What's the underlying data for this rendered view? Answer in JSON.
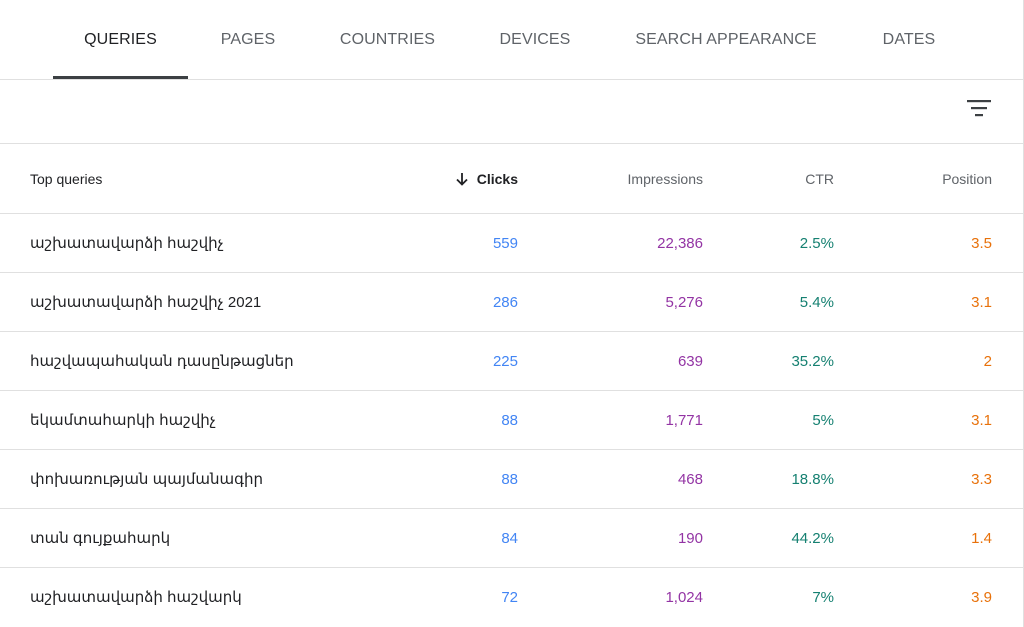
{
  "tabs": [
    {
      "label": "QUERIES",
      "active": true
    },
    {
      "label": "PAGES",
      "active": false
    },
    {
      "label": "COUNTRIES",
      "active": false
    },
    {
      "label": "DEVICES",
      "active": false
    },
    {
      "label": "SEARCH APPEARANCE",
      "active": false
    },
    {
      "label": "DATES",
      "active": false
    }
  ],
  "toolbar": {
    "filter_icon": "filter-list-icon"
  },
  "table": {
    "sorted_column": "Clicks",
    "sort_direction": "descending",
    "headers": {
      "query": "Top queries",
      "clicks": "Clicks",
      "impressions": "Impressions",
      "ctr": "CTR",
      "position": "Position"
    },
    "rows": [
      {
        "query": "աշխատավարձի հաշվիչ",
        "clicks": "559",
        "impressions": "22,386",
        "ctr": "2.5%",
        "position": "3.5"
      },
      {
        "query": "աշխատավարձի հաշվիչ 2021",
        "clicks": "286",
        "impressions": "5,276",
        "ctr": "5.4%",
        "position": "3.1"
      },
      {
        "query": "հաշվապահական դասընթացներ",
        "clicks": "225",
        "impressions": "639",
        "ctr": "35.2%",
        "position": "2"
      },
      {
        "query": "եկամտահարկի հաշվիչ",
        "clicks": "88",
        "impressions": "1,771",
        "ctr": "5%",
        "position": "3.1"
      },
      {
        "query": "փոխառության պայմանագիր",
        "clicks": "88",
        "impressions": "468",
        "ctr": "18.8%",
        "position": "3.3"
      },
      {
        "query": "տան գույքահարկ",
        "clicks": "84",
        "impressions": "190",
        "ctr": "44.2%",
        "position": "1.4"
      },
      {
        "query": "աշխատավարձի հաշվարկ",
        "clicks": "72",
        "impressions": "1,024",
        "ctr": "7%",
        "position": "3.9"
      }
    ]
  },
  "colors": {
    "clicks": "#4285f4",
    "impressions": "#9334a4",
    "ctr": "#158071",
    "position": "#e8710a",
    "tab_indicator": "#3c4043",
    "divider": "#e0e0e0"
  }
}
